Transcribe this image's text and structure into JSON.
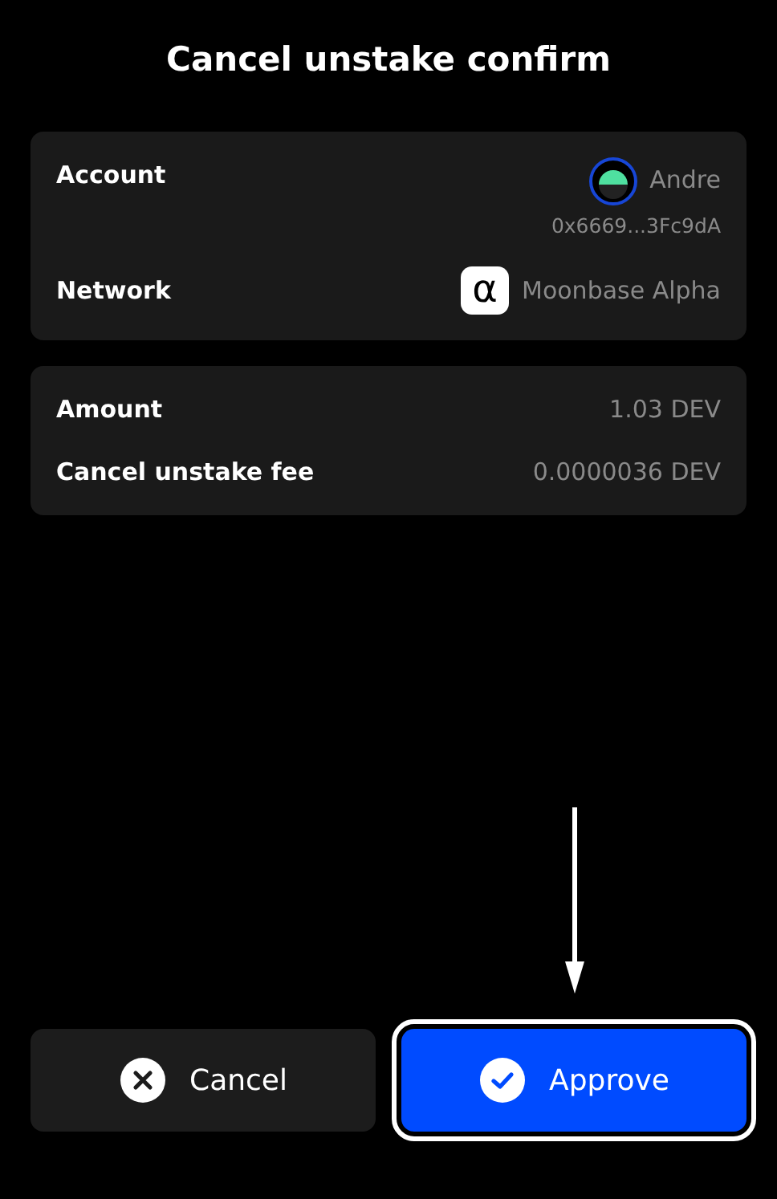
{
  "title": "Cancel unstake confirm",
  "account_card": {
    "account_label": "Account",
    "account_name": "Andre",
    "account_address": "0x6669...3Fc9dA",
    "network_label": "Network",
    "network_logo": "α",
    "network_name": "Moonbase Alpha"
  },
  "amount_card": {
    "rows": [
      {
        "label": "Amount",
        "value": "1.03 DEV"
      },
      {
        "label": "Cancel unstake fee",
        "value": "0.0000036 DEV"
      }
    ]
  },
  "buttons": [
    {
      "kind": "cancel",
      "label": "Cancel",
      "highlighted": false
    },
    {
      "kind": "approve",
      "label": "Approve",
      "highlighted": true
    }
  ]
}
